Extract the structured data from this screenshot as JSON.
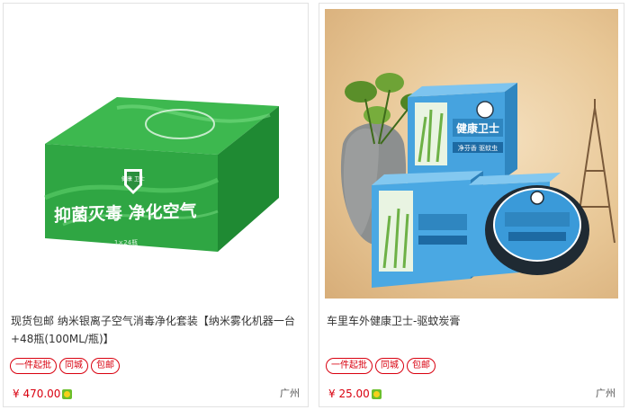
{
  "listings": [
    {
      "image_label": "抑菌灭毒  净化空气",
      "brand_badge": "健康\n卫士",
      "box_spec": "1×24瓶",
      "title": "现货包邮 纳米银离子空气消毒净化套装【纳米雾化机器一台+48瓶(100ML/瓶)】",
      "tags": [
        "一件起批",
        "同城",
        "包邮"
      ],
      "price": "¥ 470.00",
      "location": "广州"
    },
    {
      "image_label": "健康卫士",
      "image_sub": "净芬香 驱蚊虫",
      "title": "车里车外健康卫士-驱蚊炭膏",
      "tags": [
        "一件起批",
        "同城",
        "包邮"
      ],
      "price": "¥ 25.00",
      "location": "广州"
    }
  ],
  "icons": {
    "payment": "trade-assurance-icon"
  },
  "colors": {
    "accent_red": "#d9000f",
    "box_green": "#2ea844",
    "tin_blue": "#3a9ad9"
  }
}
